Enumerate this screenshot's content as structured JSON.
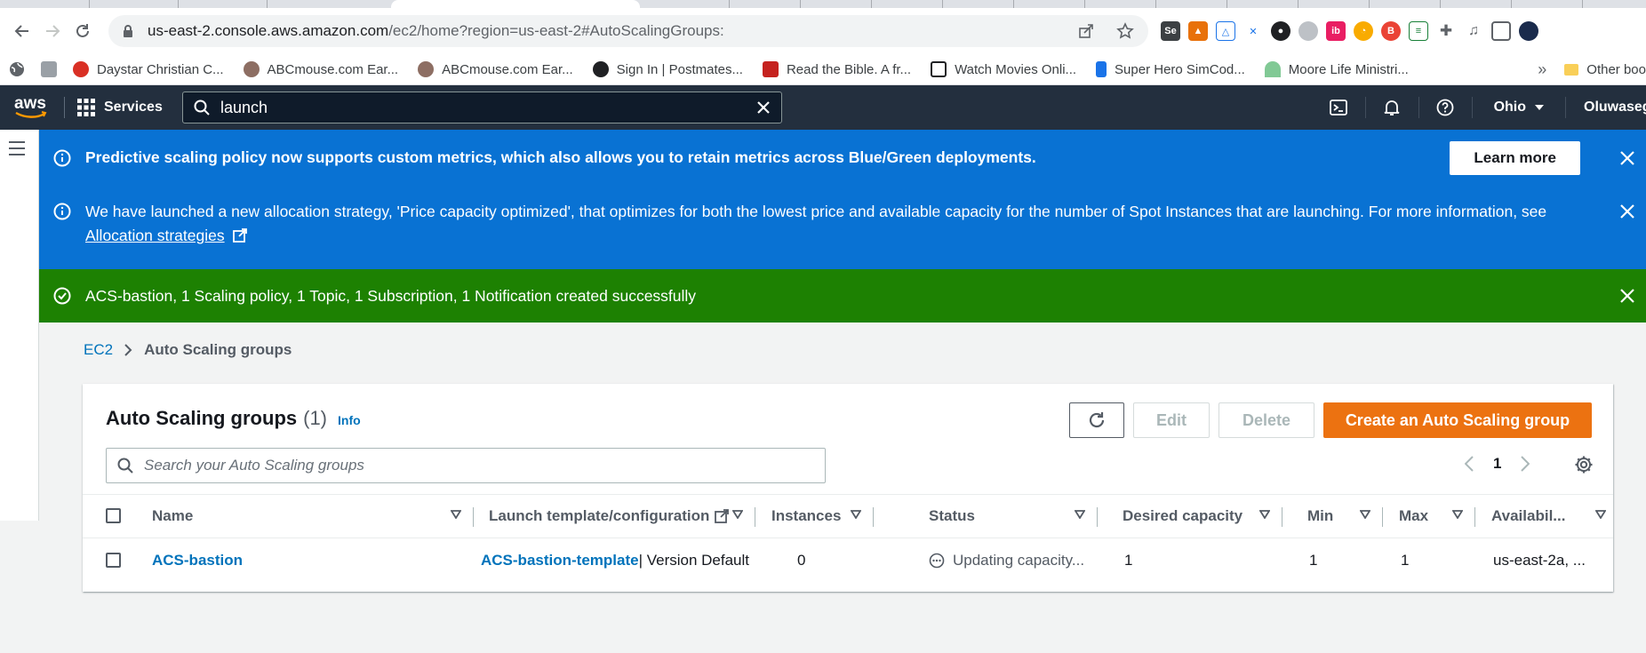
{
  "browser": {
    "url_host": "us-east-2.console.aws.amazon.com",
    "url_path": "/ec2/home?region=us-east-2#AutoScalingGroups:",
    "bookmarks": [
      "Daystar Christian C...",
      "ABCmouse.com Ear...",
      "ABCmouse.com Ear...",
      "Sign In | Postmates...",
      "Read the Bible. A fr...",
      "Watch Movies Onli...",
      "Super Hero SimCod...",
      "Moore Life Ministri..."
    ],
    "bookmarks_more": "»",
    "other_bookmarks": "Other boo"
  },
  "aws": {
    "logo": "aws",
    "services_label": "Services",
    "search_value": "launch",
    "region": "Ohio",
    "user": "Oluwaseg"
  },
  "flashbar": {
    "info1": "Predictive scaling policy now supports custom metrics, which also allows you to retain metrics across Blue/Green deployments.",
    "learn_more": "Learn more",
    "info2": "We have launched a new allocation strategy, 'Price capacity optimized', that optimizes for both the lowest price and available capacity for the number of Spot Instances that are launching. For more information, see",
    "info2_link": "Allocation strategies",
    "success": "ACS-bastion, 1 Scaling policy, 1 Topic, 1 Subscription, 1 Notification created successfully"
  },
  "breadcrumb": {
    "parent": "EC2",
    "current": "Auto Scaling groups"
  },
  "panel": {
    "title": "Auto Scaling groups",
    "count": "(1)",
    "info": "Info",
    "edit": "Edit",
    "delete": "Delete",
    "create": "Create an Auto Scaling group",
    "search_placeholder": "Search your Auto Scaling groups",
    "page": "1"
  },
  "table": {
    "columns": [
      "Name",
      "Launch template/configuration",
      "Instances",
      "Status",
      "Desired capacity",
      "Min",
      "Max",
      "Availabil..."
    ],
    "rows": [
      {
        "name": "ACS-bastion",
        "template": "ACS-bastion-template",
        "template_version": " | Version Default",
        "instances": "0",
        "status": "Updating capacity...",
        "desired": "1",
        "min": "1",
        "max": "1",
        "az": "us-east-2a, ..."
      }
    ]
  },
  "colors": {
    "aws_nav": "#232f3e",
    "info_blue": "#0972d3",
    "success_green": "#1d8102",
    "primary_orange": "#ec7211",
    "link": "#0073bb"
  }
}
